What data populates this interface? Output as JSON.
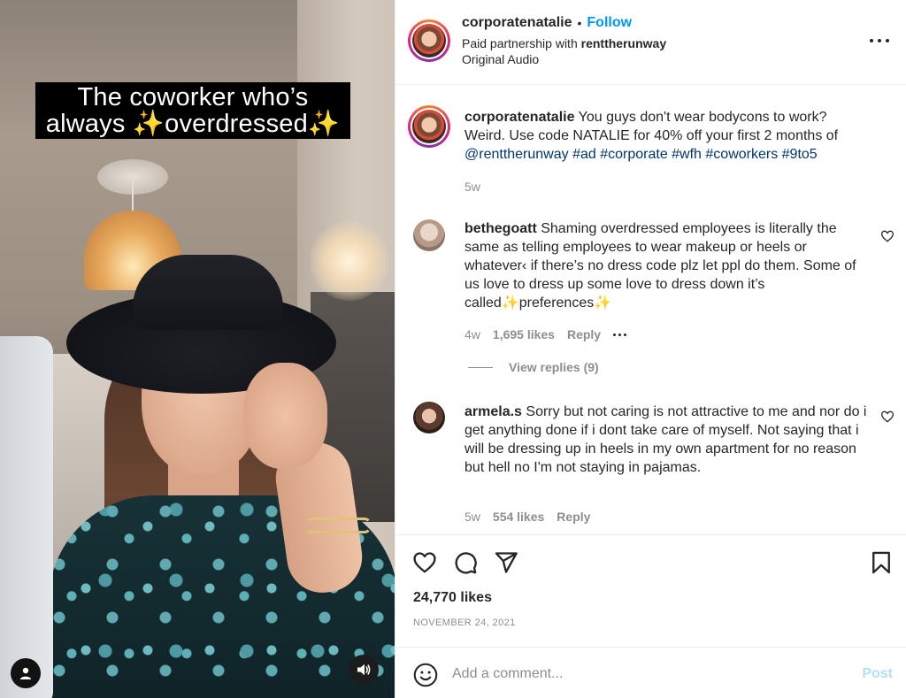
{
  "media": {
    "overlay_caption": "The coworker who’s always ✨overdressed✨",
    "user_tag_icon": "user-icon",
    "sound_icon": "speaker-icon"
  },
  "post_header": {
    "username": "corporatenatalie",
    "separator": "•",
    "follow_label": "Follow",
    "partnership_prefix": "Paid partnership with ",
    "partner": "renttherunway",
    "audio": "Original Audio",
    "more_icon": "more-horizontal-icon"
  },
  "caption": {
    "username": "corporatenatalie",
    "text": "You guys don't wear bodycons to work? Weird. Use code NATALIE for 40% off your first 2 months of ",
    "tags": "@renttherunway #ad #corporate #wfh #coworkers #9to5",
    "time": "5w"
  },
  "comments": [
    {
      "username": "bethegoatt",
      "text": "Shaming overdressed employees is literally the same as telling employees to wear makeup or heels or whatever‹ if there’s no dress code plz let ppl do them. Some of us love to dress up some love to dress down it’s called✨preferences✨",
      "time": "4w",
      "likes": "1,695 likes",
      "reply_label": "Reply",
      "view_replies": "View replies (9)"
    },
    {
      "username": "armela.s",
      "text": "Sorry but not caring is not attractive to me and nor do i get anything done if i dont take care of myself. Not saying that i will be dressing up in heels in my own apartment for no reason but hell no I'm not staying in pajamas.",
      "time": "5w",
      "likes": "554 likes",
      "reply_label": "Reply"
    }
  ],
  "actions": {
    "like_icon": "heart-icon",
    "comment_icon": "comment-icon",
    "share_icon": "share-icon",
    "save_icon": "bookmark-icon",
    "likes": "24,770 likes",
    "date": "NOVEMBER 24, 2021"
  },
  "add_comment": {
    "placeholder": "Add a comment...",
    "value": "",
    "post_label": "Post",
    "emoji_icon": "emoji-icon"
  },
  "colors": {
    "accent": "#0095f6",
    "link": "#00376b",
    "muted": "#8e8e8e",
    "post_disabled": "#b2dffc"
  }
}
